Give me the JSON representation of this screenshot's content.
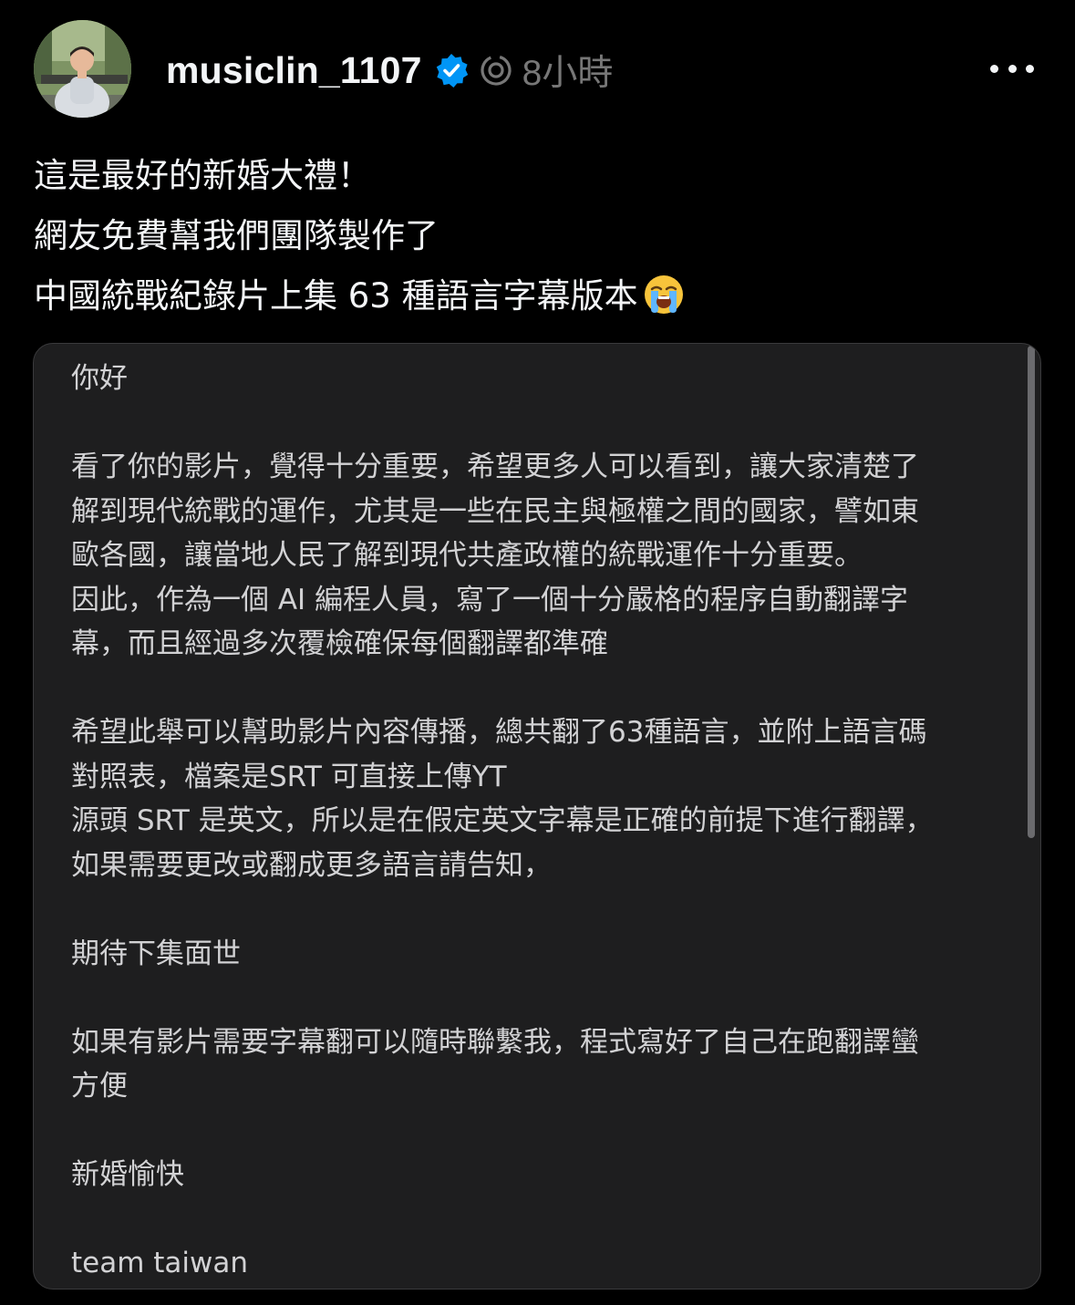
{
  "post": {
    "username": "musiclin_1107",
    "verified_icon": "verified-badge-icon",
    "app_icon": "threads-icon",
    "timestamp": "8小時",
    "more_icon": "more-options-icon",
    "avatar_icon": "profile-avatar",
    "caption": [
      "這是最好的新婚大禮！",
      "網友免費幫我們團隊製作了",
      "中國統戰紀錄片上集 63 種語言字幕版本"
    ],
    "caption_emoji": "loudly-crying-face-icon"
  },
  "letter": {
    "greeting": "你好",
    "p1": [
      "看了你的影片，覺得十分重要，希望更多人可以看到，讓大家清楚了",
      "解到現代統戰的運作，尤其是一些在民主與極權之間的國家，譬如東",
      "歐各國，讓當地人民了解到現代共產政權的統戰運作十分重要。",
      "因此，作為一個 AI 編程人員，寫了一個十分嚴格的程序自動翻譯字",
      "幕，而且經過多次覆檢確保每個翻譯都準確"
    ],
    "p2": [
      "希望此舉可以幫助影片內容傳播，總共翻了63種語言，並附上語言碼",
      "對照表，檔案是SRT 可直接上傳YT",
      "源頭 SRT 是英文，所以是在假定英文字幕是正確的前提下進行翻譯，",
      "如果需要更改或翻成更多語言請告知，"
    ],
    "p3": "期待下集面世",
    "p4": [
      "如果有影片需要字幕翻可以隨時聯繫我，程式寫好了自己在跑翻譯蠻",
      "方便"
    ],
    "p5": "新婚愉快",
    "signoff": "team taiwan"
  },
  "colors": {
    "background": "#000000",
    "card_background": "#1e1e1f",
    "primary_text": "#f3f5f7",
    "secondary_text": "#777777",
    "verified_blue": "#0095f6"
  }
}
